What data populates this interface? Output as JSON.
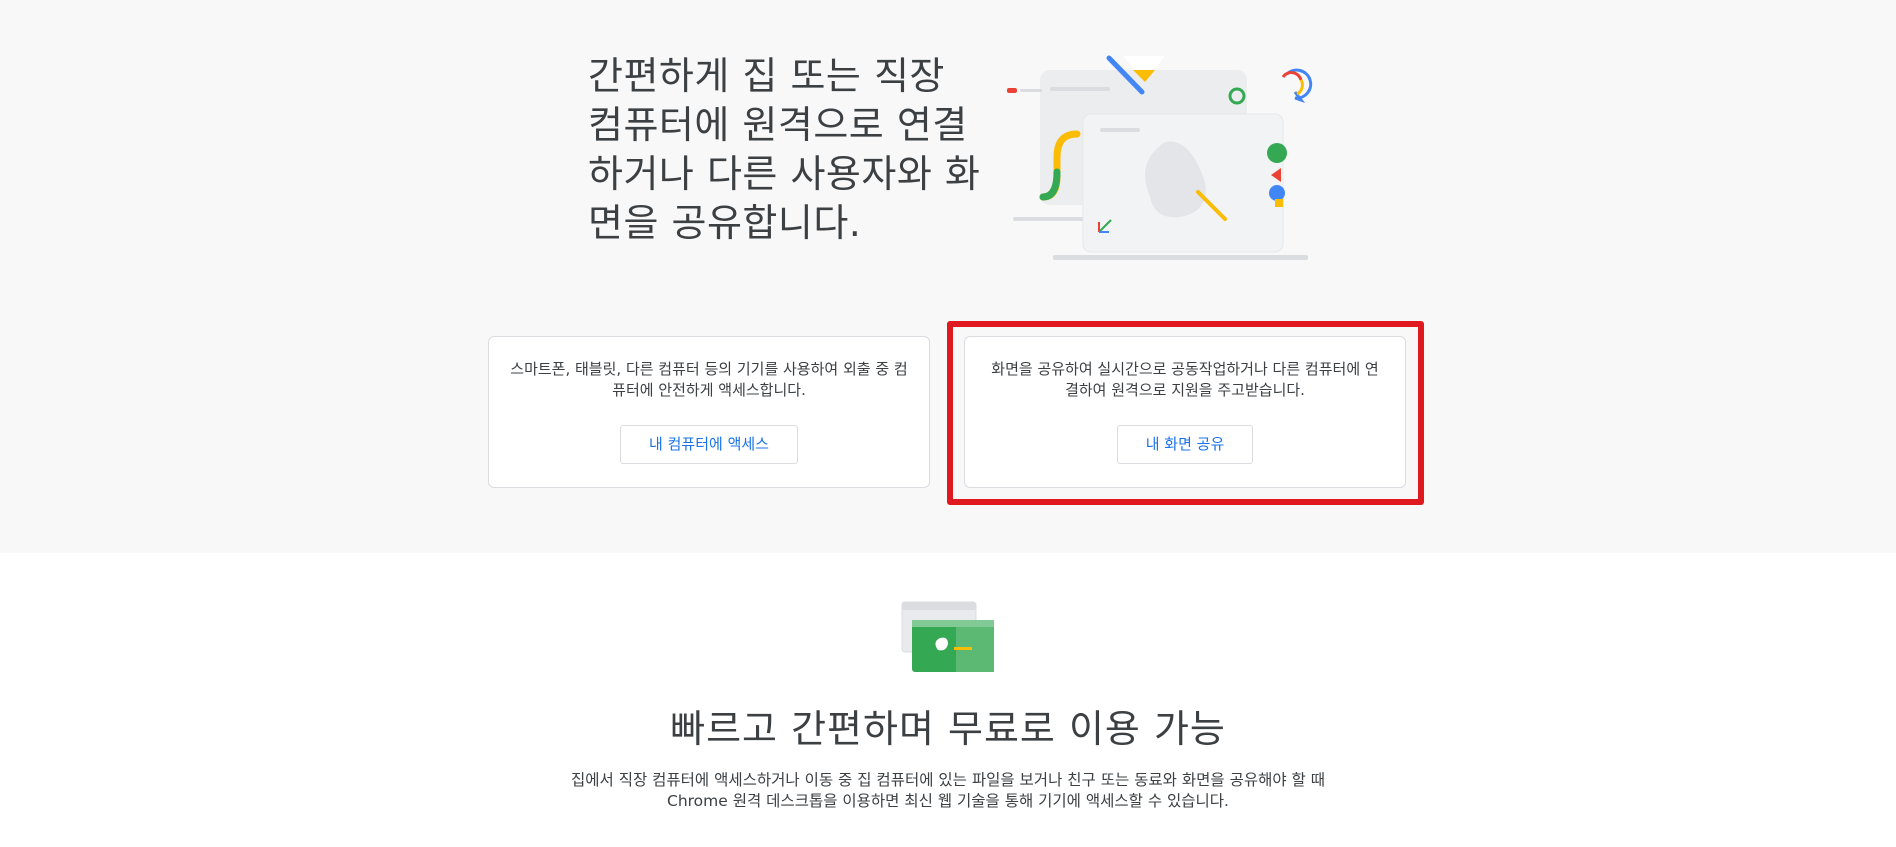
{
  "hero": {
    "title": "간편하게 집 또는 직장 컴퓨터에 원격으로 연결하거나 다른 사용자와 화면을 공유합니다.",
    "illustration": "remote-desktop-illustration"
  },
  "cards": {
    "access": {
      "description": "스마트폰, 태블릿, 다른 컴퓨터 등의 기기를 사용하여 외출 중 컴퓨터에 안전하게 액세스합니다.",
      "button_label": "내 컴퓨터에 액세스"
    },
    "share": {
      "description": "화면을 공유하여 실시간으로 공동작업하거나 다른 컴퓨터에 연결하여 원격으로 지원을 주고받습니다.",
      "button_label": "내 화면 공유"
    }
  },
  "feature": {
    "icon": "browser-windows-icon",
    "title": "빠르고 간편하며 무료로 이용 가능",
    "description": "집에서 직장 컴퓨터에 액세스하거나 이동 중 집 컴퓨터에 있는 파일을 보거나 친구 또는 동료와 화면을 공유해야 할 때 Chrome 원격 데스크톱을 이용하면 최신 웹 기술을 통해 기기에 액세스할 수 있습니다."
  },
  "colors": {
    "accent": "#1a73e8",
    "highlight": "#e0181f",
    "hero_background": "#f8f8f9",
    "green": "#34a853",
    "yellow": "#fbbc04",
    "red": "#ea4335",
    "blue": "#4285f4"
  }
}
